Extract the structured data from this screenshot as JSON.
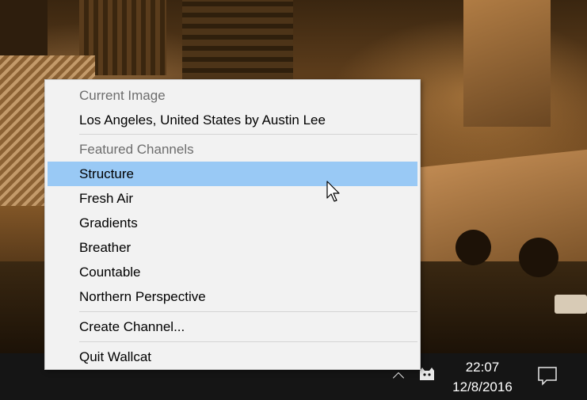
{
  "context_menu": {
    "current_image_header": "Current Image",
    "current_image_title": "Los Angeles, United States by Austin Lee",
    "featured_channels_header": "Featured Channels",
    "channels": [
      "Structure",
      "Fresh Air",
      "Gradients",
      "Breather",
      "Countable",
      "Northern Perspective"
    ],
    "highlighted_item": "Structure",
    "create_channel_label": "Create Channel...",
    "quit_label": "Quit Wallcat",
    "highlight_color": "#99c9f5"
  },
  "taskbar": {
    "time": "22:07",
    "date": "12/8/2016",
    "icons": [
      "chevron-up-icon",
      "wallcat-tray-icon",
      "notification-icon"
    ],
    "background_color": "#151515"
  }
}
